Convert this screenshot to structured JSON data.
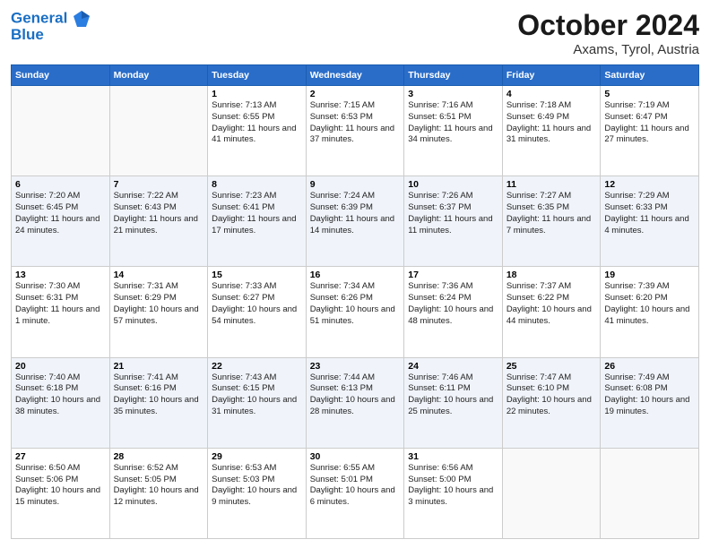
{
  "logo": {
    "line1": "General",
    "line2": "Blue"
  },
  "title": "October 2024",
  "subtitle": "Axams, Tyrol, Austria",
  "days_header": [
    "Sunday",
    "Monday",
    "Tuesday",
    "Wednesday",
    "Thursday",
    "Friday",
    "Saturday"
  ],
  "weeks": [
    [
      {
        "day": "",
        "info": ""
      },
      {
        "day": "",
        "info": ""
      },
      {
        "day": "1",
        "info": "Sunrise: 7:13 AM\nSunset: 6:55 PM\nDaylight: 11 hours and 41 minutes."
      },
      {
        "day": "2",
        "info": "Sunrise: 7:15 AM\nSunset: 6:53 PM\nDaylight: 11 hours and 37 minutes."
      },
      {
        "day": "3",
        "info": "Sunrise: 7:16 AM\nSunset: 6:51 PM\nDaylight: 11 hours and 34 minutes."
      },
      {
        "day": "4",
        "info": "Sunrise: 7:18 AM\nSunset: 6:49 PM\nDaylight: 11 hours and 31 minutes."
      },
      {
        "day": "5",
        "info": "Sunrise: 7:19 AM\nSunset: 6:47 PM\nDaylight: 11 hours and 27 minutes."
      }
    ],
    [
      {
        "day": "6",
        "info": "Sunrise: 7:20 AM\nSunset: 6:45 PM\nDaylight: 11 hours and 24 minutes."
      },
      {
        "day": "7",
        "info": "Sunrise: 7:22 AM\nSunset: 6:43 PM\nDaylight: 11 hours and 21 minutes."
      },
      {
        "day": "8",
        "info": "Sunrise: 7:23 AM\nSunset: 6:41 PM\nDaylight: 11 hours and 17 minutes."
      },
      {
        "day": "9",
        "info": "Sunrise: 7:24 AM\nSunset: 6:39 PM\nDaylight: 11 hours and 14 minutes."
      },
      {
        "day": "10",
        "info": "Sunrise: 7:26 AM\nSunset: 6:37 PM\nDaylight: 11 hours and 11 minutes."
      },
      {
        "day": "11",
        "info": "Sunrise: 7:27 AM\nSunset: 6:35 PM\nDaylight: 11 hours and 7 minutes."
      },
      {
        "day": "12",
        "info": "Sunrise: 7:29 AM\nSunset: 6:33 PM\nDaylight: 11 hours and 4 minutes."
      }
    ],
    [
      {
        "day": "13",
        "info": "Sunrise: 7:30 AM\nSunset: 6:31 PM\nDaylight: 11 hours and 1 minute."
      },
      {
        "day": "14",
        "info": "Sunrise: 7:31 AM\nSunset: 6:29 PM\nDaylight: 10 hours and 57 minutes."
      },
      {
        "day": "15",
        "info": "Sunrise: 7:33 AM\nSunset: 6:27 PM\nDaylight: 10 hours and 54 minutes."
      },
      {
        "day": "16",
        "info": "Sunrise: 7:34 AM\nSunset: 6:26 PM\nDaylight: 10 hours and 51 minutes."
      },
      {
        "day": "17",
        "info": "Sunrise: 7:36 AM\nSunset: 6:24 PM\nDaylight: 10 hours and 48 minutes."
      },
      {
        "day": "18",
        "info": "Sunrise: 7:37 AM\nSunset: 6:22 PM\nDaylight: 10 hours and 44 minutes."
      },
      {
        "day": "19",
        "info": "Sunrise: 7:39 AM\nSunset: 6:20 PM\nDaylight: 10 hours and 41 minutes."
      }
    ],
    [
      {
        "day": "20",
        "info": "Sunrise: 7:40 AM\nSunset: 6:18 PM\nDaylight: 10 hours and 38 minutes."
      },
      {
        "day": "21",
        "info": "Sunrise: 7:41 AM\nSunset: 6:16 PM\nDaylight: 10 hours and 35 minutes."
      },
      {
        "day": "22",
        "info": "Sunrise: 7:43 AM\nSunset: 6:15 PM\nDaylight: 10 hours and 31 minutes."
      },
      {
        "day": "23",
        "info": "Sunrise: 7:44 AM\nSunset: 6:13 PM\nDaylight: 10 hours and 28 minutes."
      },
      {
        "day": "24",
        "info": "Sunrise: 7:46 AM\nSunset: 6:11 PM\nDaylight: 10 hours and 25 minutes."
      },
      {
        "day": "25",
        "info": "Sunrise: 7:47 AM\nSunset: 6:10 PM\nDaylight: 10 hours and 22 minutes."
      },
      {
        "day": "26",
        "info": "Sunrise: 7:49 AM\nSunset: 6:08 PM\nDaylight: 10 hours and 19 minutes."
      }
    ],
    [
      {
        "day": "27",
        "info": "Sunrise: 6:50 AM\nSunset: 5:06 PM\nDaylight: 10 hours and 15 minutes."
      },
      {
        "day": "28",
        "info": "Sunrise: 6:52 AM\nSunset: 5:05 PM\nDaylight: 10 hours and 12 minutes."
      },
      {
        "day": "29",
        "info": "Sunrise: 6:53 AM\nSunset: 5:03 PM\nDaylight: 10 hours and 9 minutes."
      },
      {
        "day": "30",
        "info": "Sunrise: 6:55 AM\nSunset: 5:01 PM\nDaylight: 10 hours and 6 minutes."
      },
      {
        "day": "31",
        "info": "Sunrise: 6:56 AM\nSunset: 5:00 PM\nDaylight: 10 hours and 3 minutes."
      },
      {
        "day": "",
        "info": ""
      },
      {
        "day": "",
        "info": ""
      }
    ]
  ]
}
